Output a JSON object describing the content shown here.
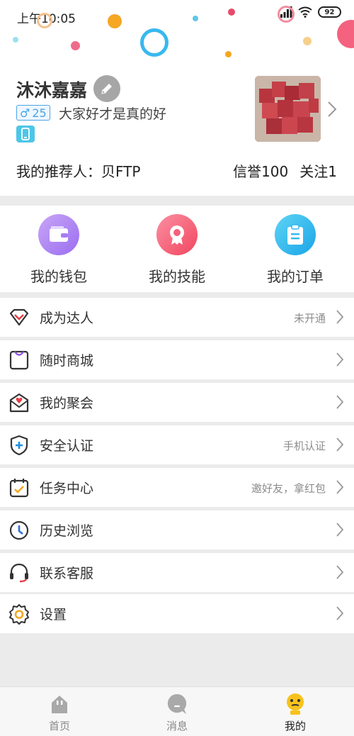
{
  "status_bar": {
    "time": "上午10:05",
    "battery": "92"
  },
  "profile": {
    "name": "沐沐嘉嘉",
    "gender_symbol": "♂",
    "age": "25",
    "signature": "大家好才是真的好",
    "referrer": "我的推荐人：贝FTP",
    "credit": "信誉100",
    "follow": "关注1"
  },
  "quick_actions": [
    {
      "label": "我的钱包",
      "icon": "wallet-icon",
      "color": "#a77cf2"
    },
    {
      "label": "我的技能",
      "icon": "skill-badge-icon",
      "color": "#f5607c"
    },
    {
      "label": "我的订单",
      "icon": "order-clipboard-icon",
      "color": "#31b9ef"
    }
  ],
  "menu": [
    {
      "label": "成为达人",
      "hint": "未开通",
      "icon": "diamond-icon"
    },
    {
      "label": "随时商城",
      "hint": "",
      "icon": "shopping-bag-icon"
    },
    {
      "label": "我的聚会",
      "hint": "",
      "icon": "heart-envelope-icon"
    },
    {
      "label": "安全认证",
      "hint": "手机认证",
      "icon": "shield-plus-icon"
    },
    {
      "label": "任务中心",
      "hint": "邀好友，拿红包",
      "icon": "calendar-check-icon"
    },
    {
      "label": "历史浏览",
      "hint": "",
      "icon": "clock-icon"
    },
    {
      "label": "联系客服",
      "hint": "",
      "icon": "headset-icon"
    },
    {
      "label": "设置",
      "hint": "",
      "icon": "gear-icon"
    }
  ],
  "tabs": [
    {
      "label": "首页",
      "icon": "home-icon",
      "active": false
    },
    {
      "label": "消息",
      "icon": "message-icon",
      "active": false
    },
    {
      "label": "我的",
      "icon": "profile-face-icon",
      "active": true
    }
  ],
  "colors": {
    "accent_blue": "#4aa3e8",
    "tab_active_yellow": "#f7c21c",
    "menu_red": "#e83d46"
  }
}
